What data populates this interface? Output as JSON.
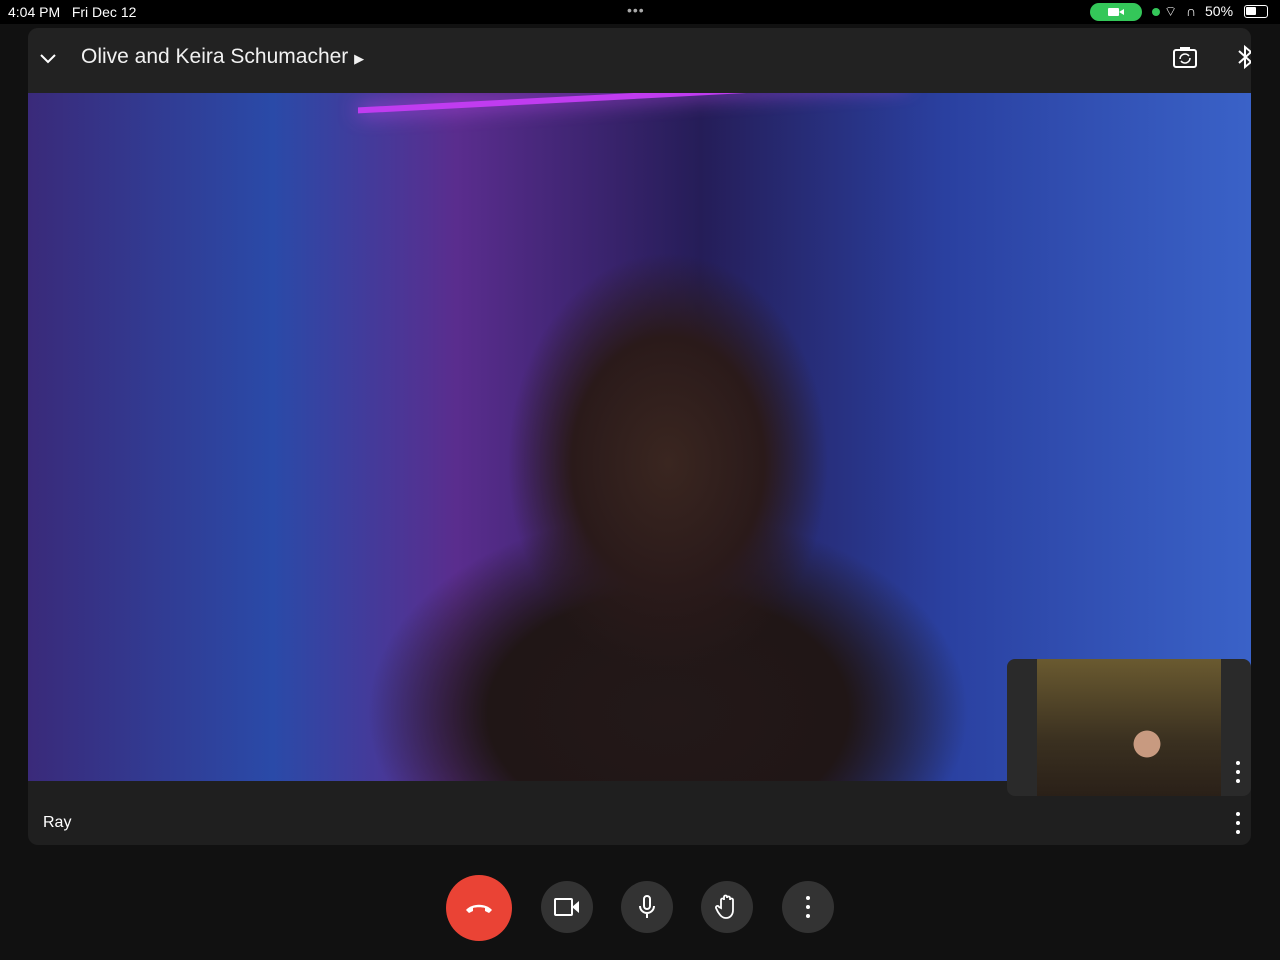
{
  "status_bar": {
    "time": "4:04 PM",
    "date": "Fri Dec 12",
    "battery": "50%",
    "colors": {
      "recording": "#34c759"
    }
  },
  "header": {
    "title": "Olive and Keira Schumacher"
  },
  "main_video": {
    "participant_name": "Ray"
  },
  "controls": {
    "end_call_color": "#ea4335"
  }
}
